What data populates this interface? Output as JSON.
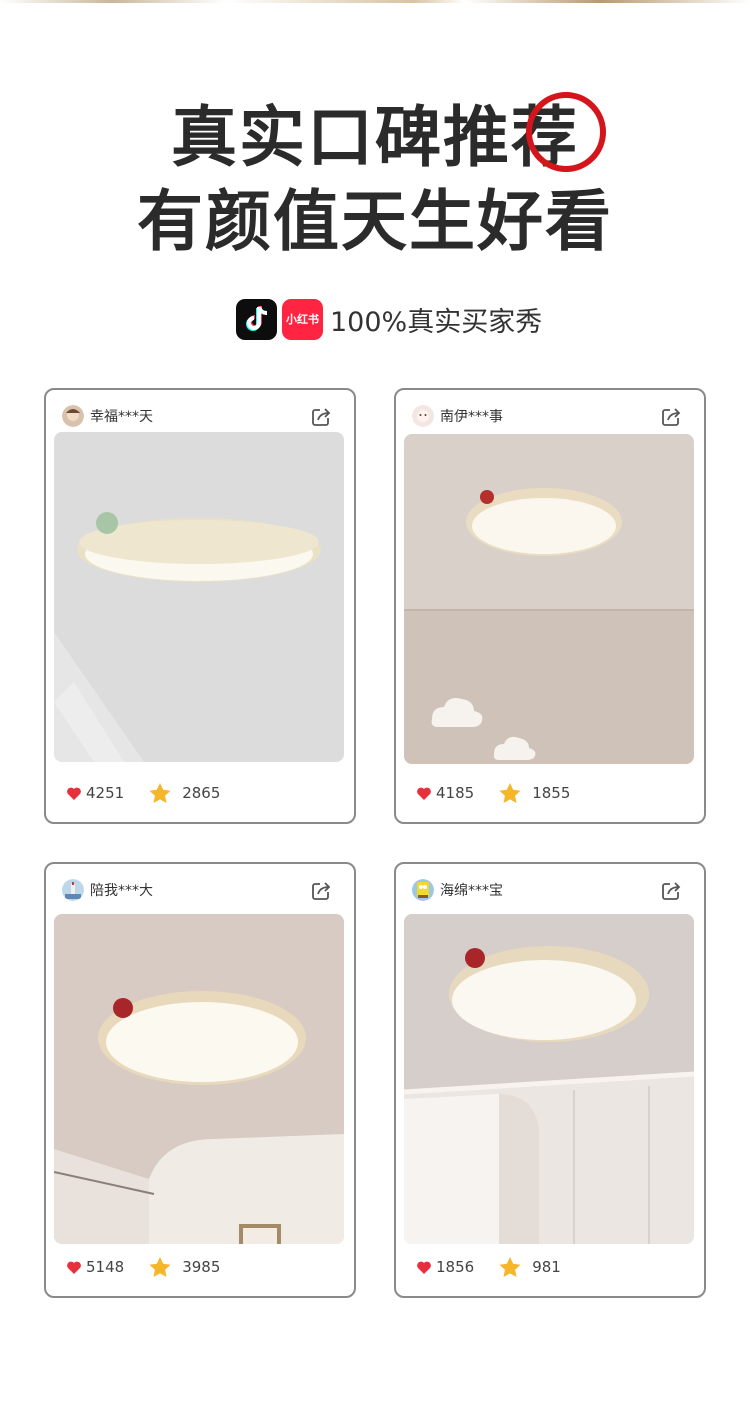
{
  "headline": {
    "line1": "真实口碑推荐",
    "line2": "有颜值天生好看"
  },
  "brands": {
    "tiktok_icon": "tiktok-icon",
    "xiaohongshu_icon_text": "小红书",
    "caption": "100%真实买家秀"
  },
  "colors": {
    "accent_red": "#d4151b",
    "heart": "#e8303c",
    "star": "#f5b62a"
  },
  "posts": [
    {
      "user": "幸福***天",
      "likes": "4251",
      "favorites": "2865"
    },
    {
      "user": "南伊***事",
      "likes": "4185",
      "favorites": "1855"
    },
    {
      "user": "陪我***大",
      "likes": "5148",
      "favorites": "3985"
    },
    {
      "user": "海绵***宝",
      "likes": "1856",
      "favorites": "981"
    }
  ]
}
